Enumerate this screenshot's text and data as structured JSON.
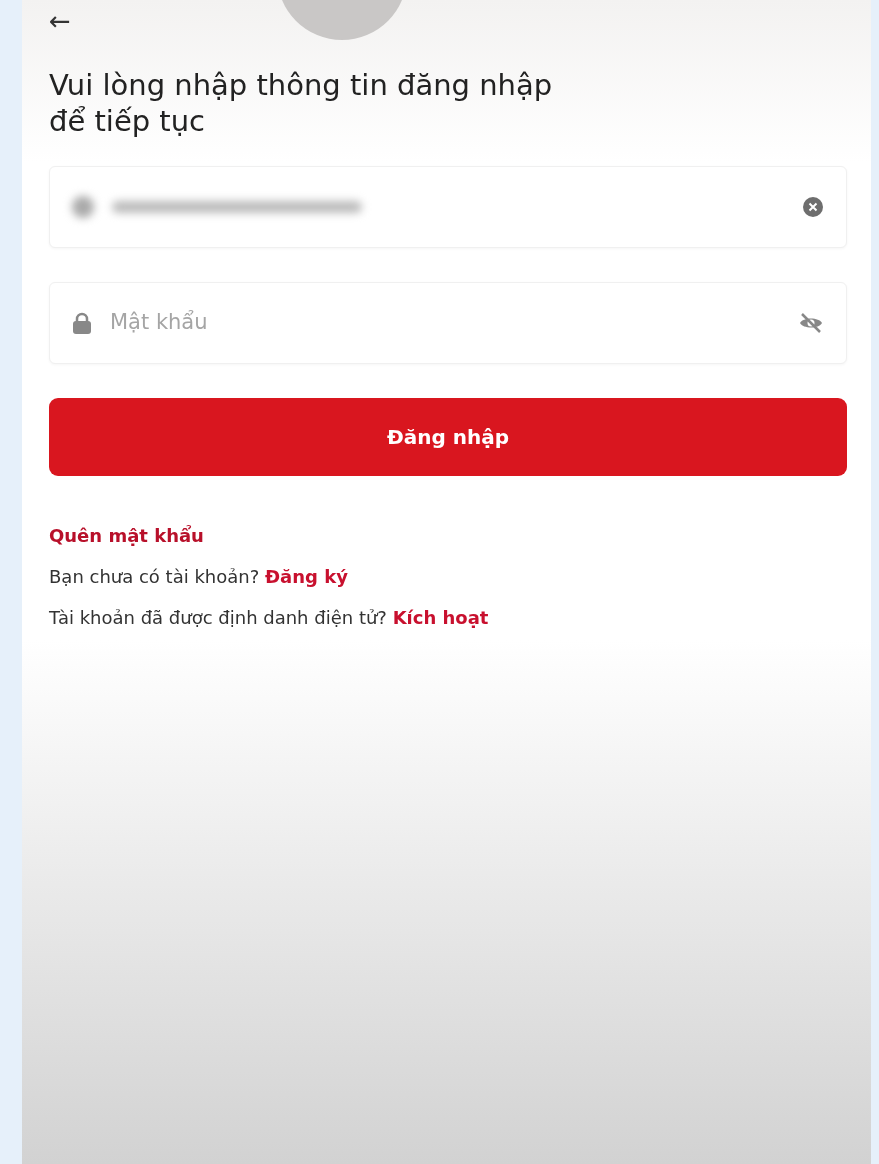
{
  "back": "←",
  "title": "Vui lòng nhập thông tin đăng nhập để tiếp tục",
  "fields": [
    {
      "kind": "account"
    },
    {
      "kind": "password",
      "placeholder": "Mật khẩu"
    }
  ],
  "login_button": "Đăng nhập",
  "forgot": "Quên mật khẩu",
  "lines": [
    {
      "text": "Bạn chưa có tài khoản?",
      "link": "Đăng ký"
    },
    {
      "text": "Tài khoản đã được định danh điện tử?",
      "link": "Kích hoạt"
    }
  ]
}
